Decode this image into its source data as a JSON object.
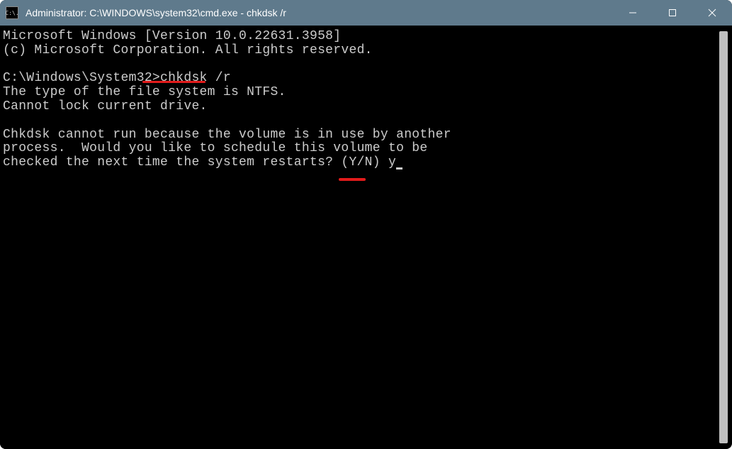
{
  "window": {
    "title": "Administrator: C:\\WINDOWS\\system32\\cmd.exe - chkdsk  /r",
    "icon_text": "C:\\."
  },
  "console": {
    "line1": "Microsoft Windows [Version 10.0.22631.3958]",
    "line2": "(c) Microsoft Corporation. All rights reserved.",
    "blank1": "",
    "prompt": "C:\\Windows\\System32>",
    "command": "chkdsk /r",
    "out1": "The type of the file system is NTFS.",
    "out2": "Cannot lock current drive.",
    "blank2": "",
    "out3": "Chkdsk cannot run because the volume is in use by another",
    "out4": "process.  Would you like to schedule this volume to be",
    "out5": "checked the next time the system restarts? (Y/N) ",
    "response": "y"
  }
}
